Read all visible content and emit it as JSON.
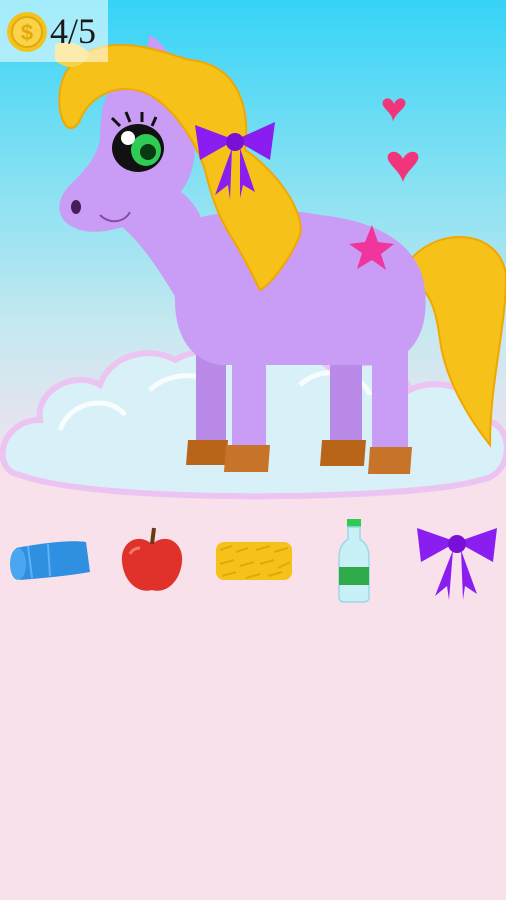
{
  "hud": {
    "coins_collected": 4,
    "coins_total": 5,
    "counter_text": "4/5",
    "coin_icon": "dollar-coin-icon"
  },
  "pony": {
    "body_color": "#c99cf5",
    "mane_color": "#f6c21a",
    "bow_color": "#8a1ef0",
    "star_mark_color": "#f0359c",
    "hoof_color": "#b8651a"
  },
  "scene_decor": [
    "heart-icon",
    "heart-icon",
    "cloud"
  ],
  "items": [
    {
      "name": "blue-towel-roll-icon"
    },
    {
      "name": "red-apple-icon"
    },
    {
      "name": "hay-bale-icon"
    },
    {
      "name": "water-bottle-icon"
    },
    {
      "name": "purple-bow-icon"
    }
  ]
}
